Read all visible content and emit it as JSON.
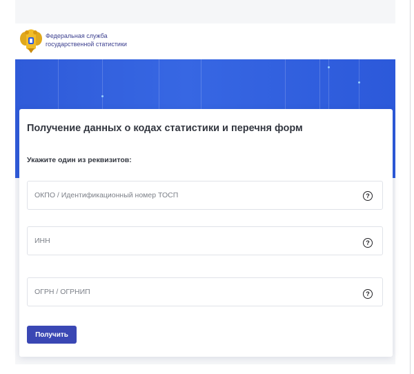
{
  "header": {
    "org_line1": "Федеральная служба",
    "org_line2": "государственной статистики",
    "logo_icon": "double-headed-eagle-emblem"
  },
  "form": {
    "title": "Получение данных о кодах статистики и перечня форм",
    "subtitle": "Укажите один из реквизитов:",
    "fields": [
      {
        "placeholder": "ОКПО / Идентификационный номер ТОСП",
        "value": "",
        "help_icon": "question-circle-icon"
      },
      {
        "placeholder": "ИНН",
        "value": "",
        "help_icon": "question-circle-icon"
      },
      {
        "placeholder": "ОГРН / ОГРНИП",
        "value": "",
        "help_icon": "question-circle-icon"
      }
    ],
    "submit_label": "Получить"
  },
  "colors": {
    "banner": "#3767e3",
    "button": "#3a47b4",
    "org_text": "#3b3f8f"
  }
}
